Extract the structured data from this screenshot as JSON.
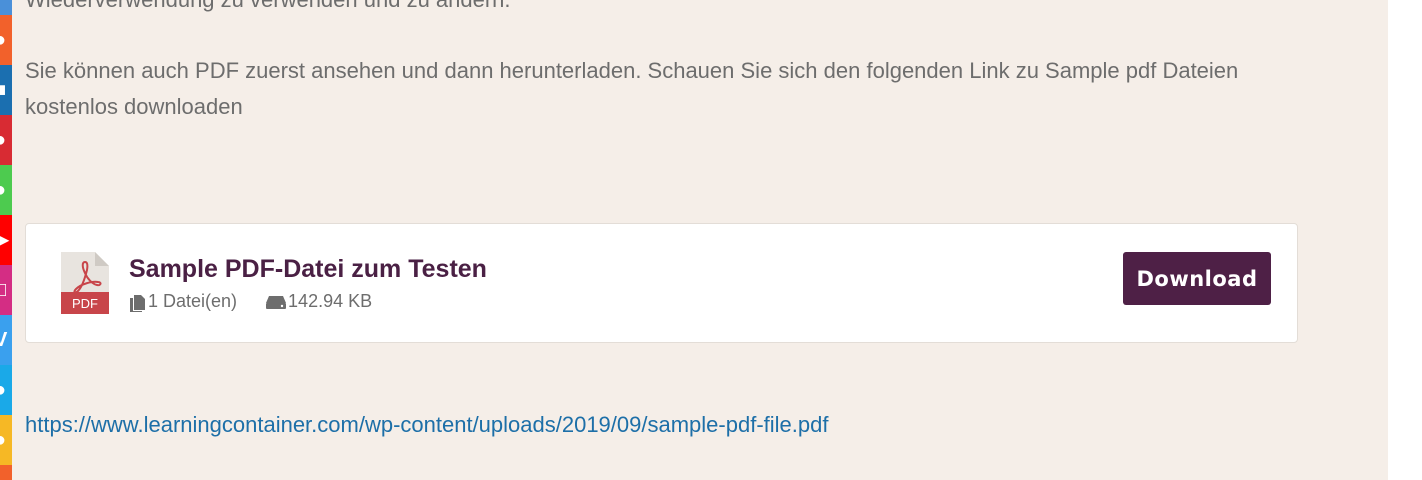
{
  "share_bar": {
    "colors": [
      "#4a90d9",
      "#f2612b",
      "#1b6fb0",
      "#d82b33",
      "#4dcb4f",
      "#ff0000",
      "#d42d84",
      "#3aa0ee",
      "#1aa9e8",
      "#f6b825",
      "#f2612b"
    ]
  },
  "content": {
    "cut_line": "Wiederverwendung zu verwenden und zu ändern.",
    "paragraph": "Sie können auch PDF zuerst ansehen und dann herunterladen. Schauen Sie sich den folgenden Link zu Sample pdf Dateien kostenlos downloaden"
  },
  "download_card": {
    "icon_label": "PDF",
    "title": "Sample PDF-Datei zum Testen",
    "file_count": "1 Datei(en)",
    "file_size": "142.94 KB",
    "button_label": "Download"
  },
  "link": {
    "url": "https://www.learningcontainer.com/wp-content/uploads/2019/09/sample-pdf-file.pdf"
  },
  "colors": {
    "page_background": "#f5eee8",
    "title": "#4a2044",
    "button": "#4e2046",
    "link": "#1d6fa8",
    "body_text": "#6d6d6d"
  }
}
